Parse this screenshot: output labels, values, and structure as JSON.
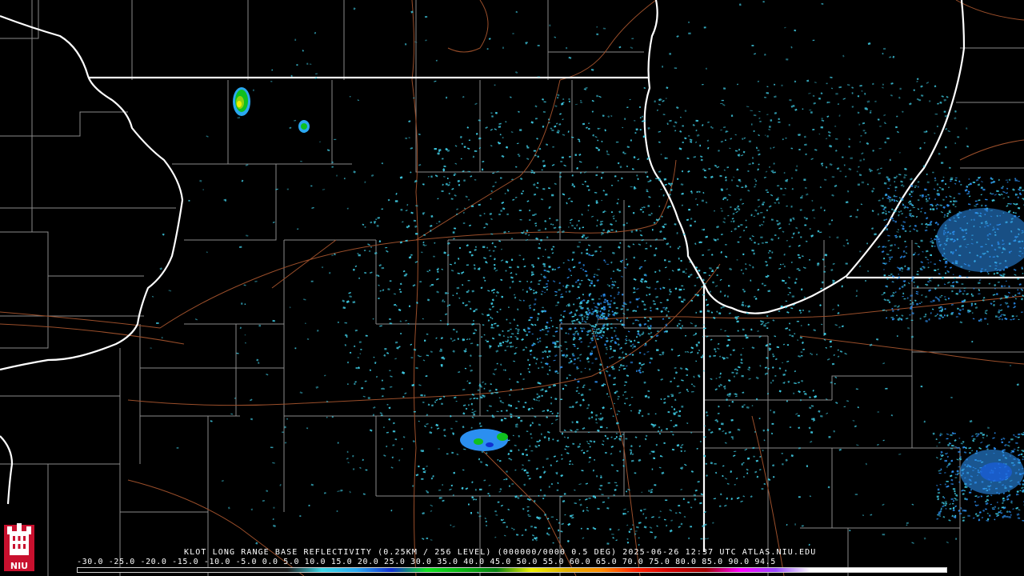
{
  "product": {
    "caption": "KLOT LONG RANGE BASE REFLECTIVITY (0.25KM / 256 LEVEL) (000000/0000 0.5 DEG) 2025-06-26 12:37 UTC  ATLAS.NIU.EDU",
    "radar_site": "KLOT",
    "timestamp": "2025-06-26 12:37 UTC",
    "source": "ATLAS.NIU.EDU"
  },
  "scale": {
    "labels": "-30.0 -25.0 -20.0 -15.0 -10.0 -5.0  0.0  5.0  10.0 15.0 20.0 25.0 30.0 35.0 40.0 45.0 50.0 55.0 60.0 65.0 70.0 75.0 80.0 85.0 90.0 94.5",
    "stops": [
      {
        "value": -30,
        "color": "#000000"
      },
      {
        "value": -10,
        "color": "#0d0d0d"
      },
      {
        "value": 0,
        "color": "#1a1a1a"
      },
      {
        "value": 5,
        "color": "#3bd7e6"
      },
      {
        "value": 10,
        "color": "#2aa8f0"
      },
      {
        "value": 15,
        "color": "#1030d0"
      },
      {
        "value": 20,
        "color": "#10e020"
      },
      {
        "value": 25,
        "color": "#08b410"
      },
      {
        "value": 30,
        "color": "#058010"
      },
      {
        "value": 35,
        "color": "#f0f000"
      },
      {
        "value": 40,
        "color": "#e0b000"
      },
      {
        "value": 45,
        "color": "#ff8c00"
      },
      {
        "value": 50,
        "color": "#ff2000"
      },
      {
        "value": 55,
        "color": "#d00000"
      },
      {
        "value": 60,
        "color": "#a00000"
      },
      {
        "value": 65,
        "color": "#ff00ff"
      },
      {
        "value": 70,
        "color": "#9848ff"
      },
      {
        "value": 75,
        "color": "#ffffff"
      },
      {
        "value": 94.5,
        "color": "#ffffff"
      }
    ]
  },
  "logo": {
    "text": "NIU",
    "bg_color": "#c8102e"
  },
  "colors": {
    "background": "#000000",
    "state_lines": "#ffffff",
    "county_lines": "#8a8a8a",
    "highways": "#a0522d",
    "echo_light": "#3ec8e0",
    "echo_medium": "#2b8ff0",
    "echo_strong": "#10e020",
    "echo_peak": "#f0f000"
  }
}
